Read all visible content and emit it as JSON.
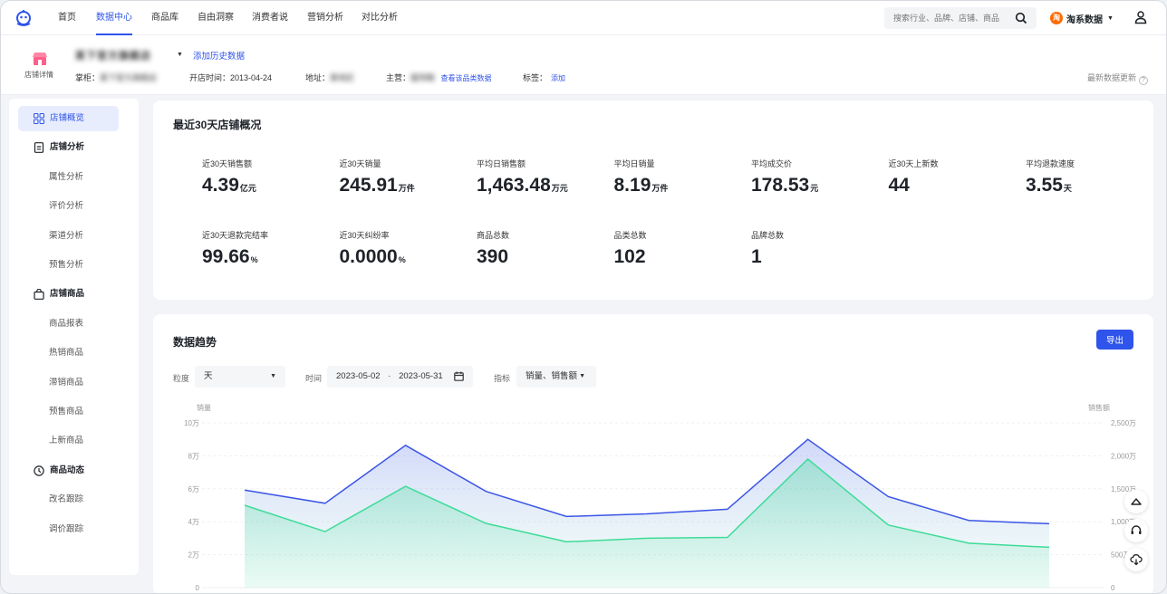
{
  "nav": {
    "items": [
      "首页",
      "数据中心",
      "商品库",
      "自由洞察",
      "消费者说",
      "营销分析",
      "对比分析"
    ],
    "active_index": 1,
    "search_placeholder": "搜索行业、品牌、店铺、商品",
    "brand_label": "淘系数据"
  },
  "shop": {
    "avatar_caption": "店铺详情",
    "name": "某下官方旗舰店",
    "add_history": "添加历史数据",
    "owner_label": "掌柜：",
    "owner_value": "某下官方旗舰店",
    "open_label": "开店时间：",
    "open_value": "2013-04-24",
    "address_label": "地址：",
    "address_value": "某地区",
    "main_label": "主营：",
    "main_value": "服饰鞋",
    "main_link": "查看该品类数据",
    "tag_label": "标签：",
    "tag_link": "添加",
    "refresh_label": "最新数据更新"
  },
  "sidebar": {
    "items": [
      {
        "label": "店铺概览",
        "type": "group",
        "icon": "grid-icon"
      },
      {
        "label": "店铺分析",
        "type": "group",
        "icon": "document-icon"
      },
      {
        "label": "属性分析",
        "type": "sub"
      },
      {
        "label": "评价分析",
        "type": "sub"
      },
      {
        "label": "渠道分析",
        "type": "sub"
      },
      {
        "label": "预售分析",
        "type": "sub"
      },
      {
        "label": "店铺商品",
        "type": "group",
        "icon": "bag-icon"
      },
      {
        "label": "商品报表",
        "type": "sub"
      },
      {
        "label": "热销商品",
        "type": "sub"
      },
      {
        "label": "滞销商品",
        "type": "sub"
      },
      {
        "label": "预售商品",
        "type": "sub"
      },
      {
        "label": "上新商品",
        "type": "sub"
      },
      {
        "label": "商品动态",
        "type": "group",
        "icon": "clock-icon"
      },
      {
        "label": "改名跟踪",
        "type": "sub"
      },
      {
        "label": "调价跟踪",
        "type": "sub"
      }
    ]
  },
  "overview": {
    "title": "最近30天店铺概况",
    "metrics": [
      {
        "label": "近30天销售额",
        "value": "4.39",
        "unit": "亿元"
      },
      {
        "label": "近30天销量",
        "value": "245.91",
        "unit": "万件"
      },
      {
        "label": "平均日销售额",
        "value": "1,463.48",
        "unit": "万元"
      },
      {
        "label": "平均日销量",
        "value": "8.19",
        "unit": "万件"
      },
      {
        "label": "平均成交价",
        "value": "178.53",
        "unit": "元"
      },
      {
        "label": "近30天上新数",
        "value": "44",
        "unit": ""
      },
      {
        "label": "平均退款速度",
        "value": "3.55",
        "unit": "天"
      },
      {
        "label": "近30天退款完结率",
        "value": "99.66",
        "unit": "%"
      },
      {
        "label": "近30天纠纷率",
        "value": "0.0000",
        "unit": "%"
      },
      {
        "label": "商品总数",
        "value": "390",
        "unit": ""
      },
      {
        "label": "品类总数",
        "value": "102",
        "unit": ""
      },
      {
        "label": "品牌总数",
        "value": "1",
        "unit": ""
      }
    ]
  },
  "trend": {
    "title": "数据趋势",
    "export_label": "导出",
    "granularity_label": "粒度",
    "granularity_value": "天",
    "time_label": "时间",
    "date_start": "2023-05-02",
    "date_sep": "-",
    "date_end": "2023-05-31",
    "metric_label": "指标",
    "metric_value": "销量、销售额"
  },
  "chart_data": {
    "type": "line",
    "ylabel_left": "销量",
    "ylabel_right": "销售额",
    "left_ticks": [
      "0",
      "2万",
      "4万",
      "6万",
      "8万",
      "10万"
    ],
    "right_ticks": [
      "0",
      "500万",
      "1,000万",
      "1,500万",
      "2,000万",
      "2,500万"
    ],
    "ylim_left": [
      0,
      100000
    ],
    "ylim_right": [
      0,
      25000000
    ],
    "series": [
      {
        "name": "销售额",
        "axis": "right",
        "color": "#3b55e6",
        "values": [
          14800000,
          12800000,
          21600000,
          14600000,
          10800000,
          11200000,
          11900000,
          22500000,
          13800000,
          10200000,
          9700000
        ]
      },
      {
        "name": "销量",
        "axis": "left",
        "color": "#3ddc97",
        "values": [
          50000,
          34000,
          61500,
          39000,
          27800,
          30000,
          30500,
          78000,
          38000,
          27000,
          24500
        ]
      }
    ]
  },
  "colors": {
    "accent": "#2f54eb",
    "sales_line": "#3b55e6",
    "volume_line": "#3ddc97"
  }
}
